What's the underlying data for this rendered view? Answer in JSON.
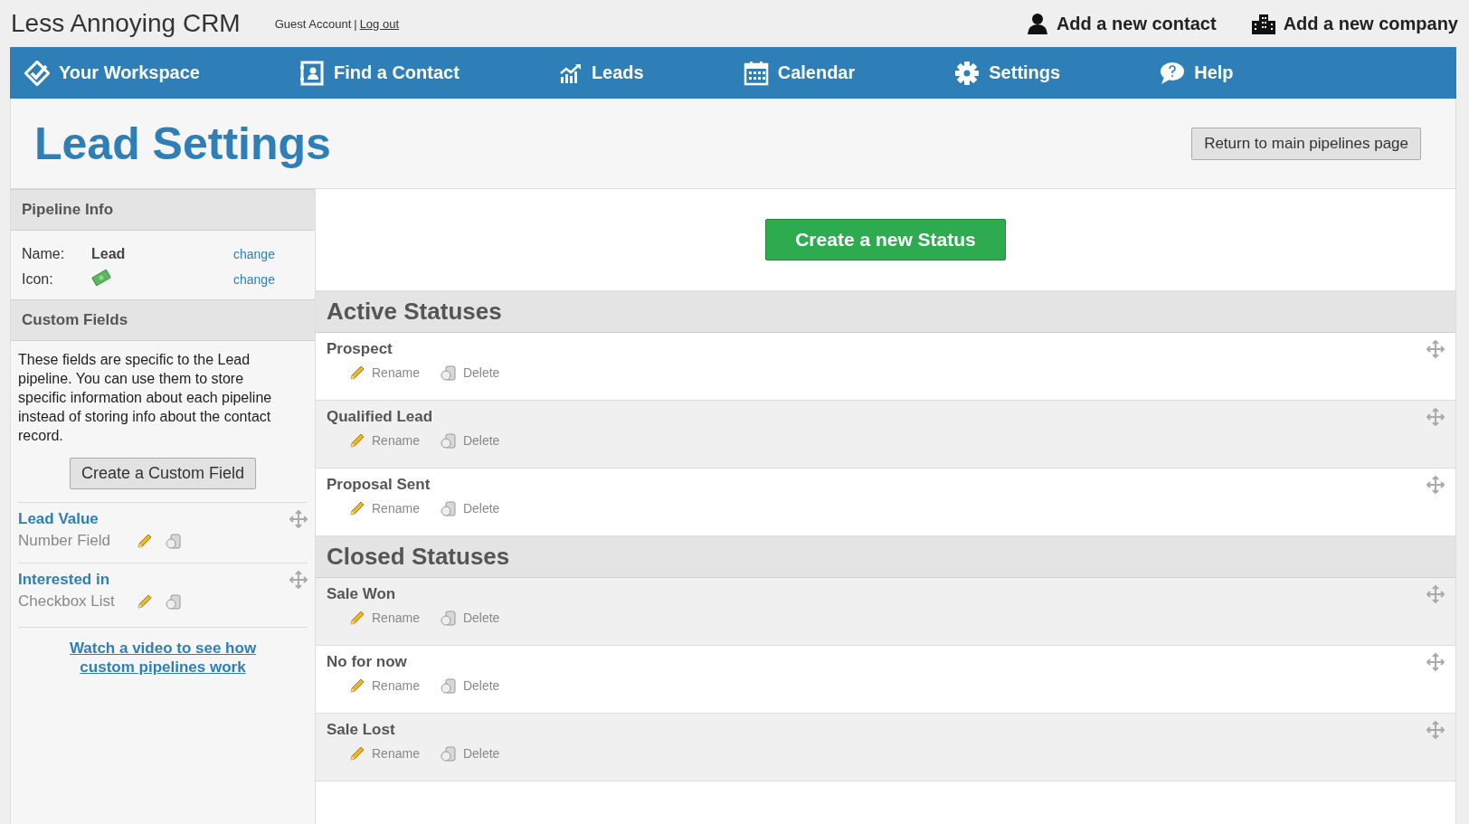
{
  "app_name": "Less Annoying CRM",
  "account": {
    "label": "Guest Account",
    "separator": "|",
    "logout": "Log out"
  },
  "quick_actions": [
    {
      "label": "Add a new contact",
      "kind": "person"
    },
    {
      "label": "Add a new company",
      "kind": "company"
    }
  ],
  "nav": [
    {
      "label": "Your Workspace",
      "kind": "workspace"
    },
    {
      "label": "Find a Contact",
      "kind": "contact"
    },
    {
      "label": "Leads",
      "kind": "leads"
    },
    {
      "label": "Calendar",
      "kind": "calendar"
    },
    {
      "label": "Settings",
      "kind": "settings"
    },
    {
      "label": "Help",
      "kind": "help"
    }
  ],
  "page_title": "Lead Settings",
  "return_button": "Return to main pipelines page",
  "pipeline_info": {
    "heading": "Pipeline Info",
    "name_label": "Name:",
    "name": "Lead",
    "icon_label": "Icon:",
    "change": "change",
    "icon_change": "change"
  },
  "custom_fields": {
    "heading": "Custom Fields",
    "description": "These fields are specific to the Lead pipeline. You can use them to store specific information about each pipeline instead of storing info about the contact record.",
    "create_button": "Create a Custom Field",
    "fields": [
      {
        "name": "Lead Value",
        "type": "Number Field"
      },
      {
        "name": "Interested in",
        "type": "Checkbox List"
      }
    ],
    "video_link": "Watch a video to see how custom pipelines work"
  },
  "create_status_button": "Create a new Status",
  "sections": [
    {
      "heading": "Active Statuses",
      "statuses": [
        {
          "name": "Prospect",
          "rename": "Rename",
          "delete": "Delete"
        },
        {
          "name": "Qualified Lead",
          "rename": "Rename",
          "delete": "Delete"
        },
        {
          "name": "Proposal Sent",
          "rename": "Rename",
          "delete": "Delete"
        }
      ]
    },
    {
      "heading": "Closed Statuses",
      "statuses": [
        {
          "name": "Sale Won",
          "rename": "Rename",
          "delete": "Delete"
        },
        {
          "name": "No for now",
          "rename": "Rename",
          "delete": "Delete"
        },
        {
          "name": "Sale Lost",
          "rename": "Rename",
          "delete": "Delete"
        }
      ]
    }
  ]
}
